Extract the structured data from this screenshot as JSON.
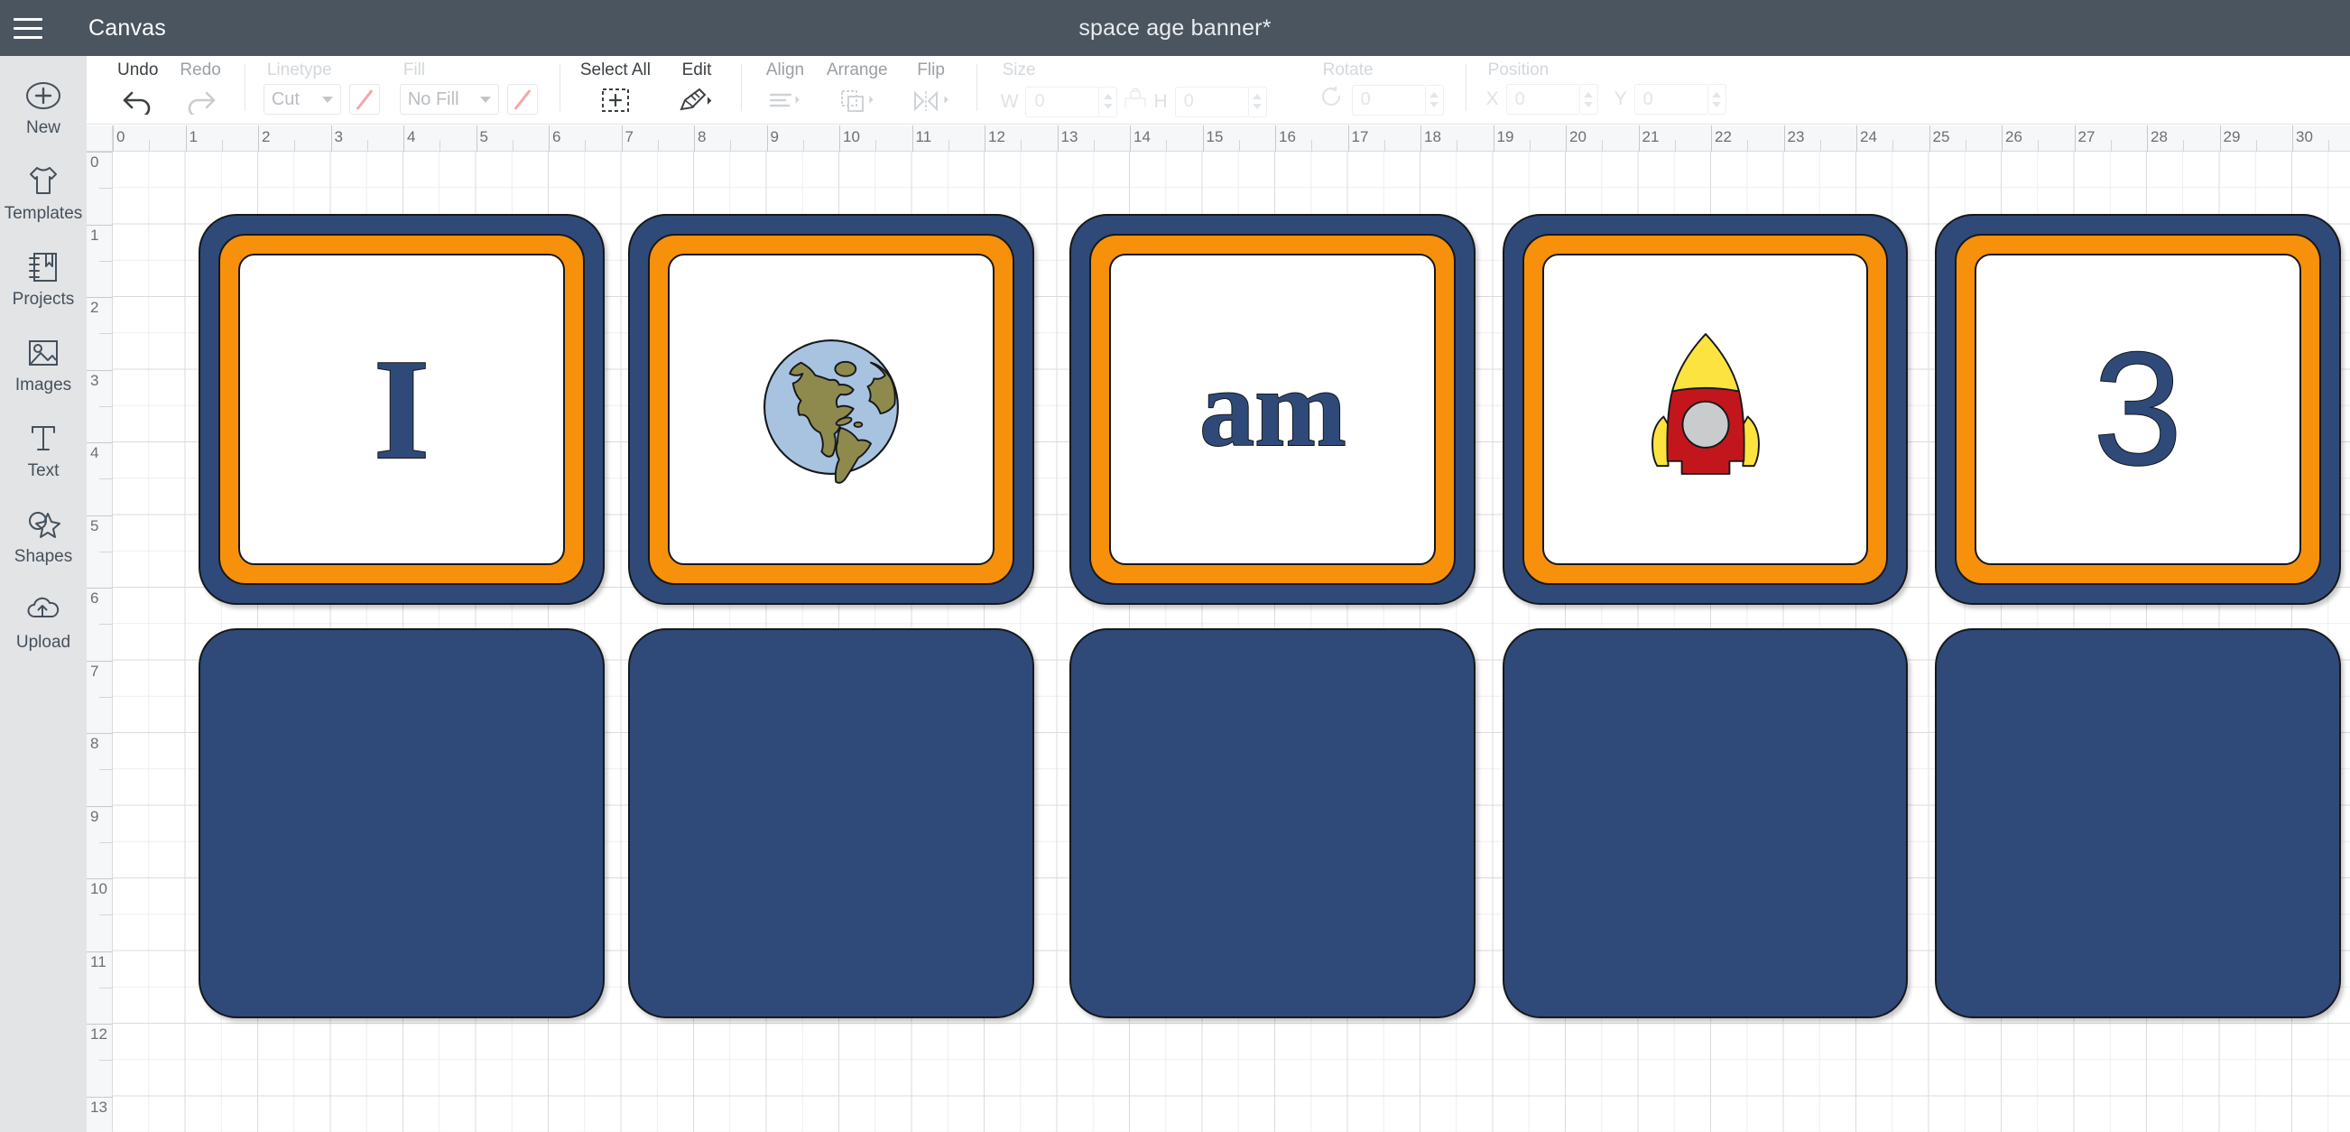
{
  "titlebar": {
    "menu_icon": "hamburger-icon",
    "app_section": "Canvas",
    "document_title": "space age banner*"
  },
  "toolbar": {
    "undo": {
      "label": "Undo",
      "icon": "undo-arrow-icon",
      "enabled": true
    },
    "redo": {
      "label": "Redo",
      "icon": "redo-arrow-icon",
      "enabled": false
    },
    "linetype": {
      "label": "Linetype",
      "value": "Cut",
      "swatch_icon": "no-color-slash-icon"
    },
    "fill": {
      "label": "Fill",
      "value": "No Fill",
      "swatch_icon": "no-color-slash-icon"
    },
    "select_all": {
      "label": "Select All",
      "icon": "select-all-marquee-icon"
    },
    "edit": {
      "label": "Edit",
      "icon": "edit-pencil-ruler-icon"
    },
    "align": {
      "label": "Align",
      "icon": "align-lines-icon"
    },
    "arrange": {
      "label": "Arrange",
      "icon": "arrange-layers-icon"
    },
    "flip": {
      "label": "Flip",
      "icon": "flip-horizontal-icon"
    },
    "size": {
      "label": "Size",
      "lock_icon": "lock-closed-icon",
      "w_label": "W",
      "w_value": "0",
      "h_label": "H",
      "h_value": "0"
    },
    "rotate": {
      "label": "Rotate",
      "icon": "rotate-cw-icon",
      "value": "0"
    },
    "position": {
      "label": "Position",
      "x_label": "X",
      "x_value": "0",
      "y_label": "Y",
      "y_value": "0"
    }
  },
  "sidebar": {
    "items": [
      {
        "label": "New",
        "icon": "plus-circle-icon"
      },
      {
        "label": "Templates",
        "icon": "tshirt-icon"
      },
      {
        "label": "Projects",
        "icon": "book-bookmark-icon"
      },
      {
        "label": "Images",
        "icon": "picture-icon"
      },
      {
        "label": "Text",
        "icon": "text-t-icon"
      },
      {
        "label": "Shapes",
        "icon": "shapes-star-icon"
      },
      {
        "label": "Upload",
        "icon": "cloud-upload-icon"
      }
    ]
  },
  "rulers": {
    "horizontal_unit_labels": [
      "0",
      "1",
      "2",
      "3",
      "4",
      "5",
      "6",
      "7",
      "8",
      "9",
      "10",
      "11",
      "12",
      "13",
      "14",
      "15",
      "16",
      "17",
      "18",
      "19",
      "20",
      "21",
      "22",
      "23",
      "24",
      "25",
      "26",
      "27",
      "28",
      "29",
      "30"
    ],
    "vertical_unit_labels": [
      "0",
      "1",
      "2",
      "3",
      "4",
      "5",
      "6",
      "7",
      "8",
      "9",
      "10",
      "11",
      "12",
      "13"
    ]
  },
  "colors": {
    "navy": "#2f4a78",
    "orange": "#f7900a",
    "outline": "#16181b",
    "white": "#ffffff",
    "globe_ocean": "#a8c3e0",
    "globe_land": "#8e8a4e",
    "rocket_body": "#c3161c",
    "rocket_nose": "#fde33f",
    "rocket_window": "#c9cbcc",
    "titlebar": "#4a5560",
    "sidebar": "#e3e4e6"
  },
  "canvas_objects": {
    "top_row": [
      {
        "name": "card-letter-i",
        "type": "framed-card",
        "content_kind": "text",
        "text": "I",
        "font_style": "serif"
      },
      {
        "name": "card-globe",
        "type": "framed-card",
        "content_kind": "image",
        "image": "earth-globe-americas"
      },
      {
        "name": "card-word-am",
        "type": "framed-card",
        "content_kind": "text",
        "text": "am",
        "font_style": "serif"
      },
      {
        "name": "card-rocket",
        "type": "framed-card",
        "content_kind": "image",
        "image": "rocket-ship"
      },
      {
        "name": "card-number-3",
        "type": "framed-card",
        "content_kind": "text",
        "text": "3",
        "font_style": "sans"
      }
    ],
    "bottom_row": [
      {
        "name": "card-blank-1",
        "type": "solid-card"
      },
      {
        "name": "card-blank-2",
        "type": "solid-card"
      },
      {
        "name": "card-blank-3",
        "type": "solid-card"
      },
      {
        "name": "card-blank-4",
        "type": "solid-card"
      },
      {
        "name": "card-blank-5",
        "type": "solid-card"
      }
    ]
  }
}
